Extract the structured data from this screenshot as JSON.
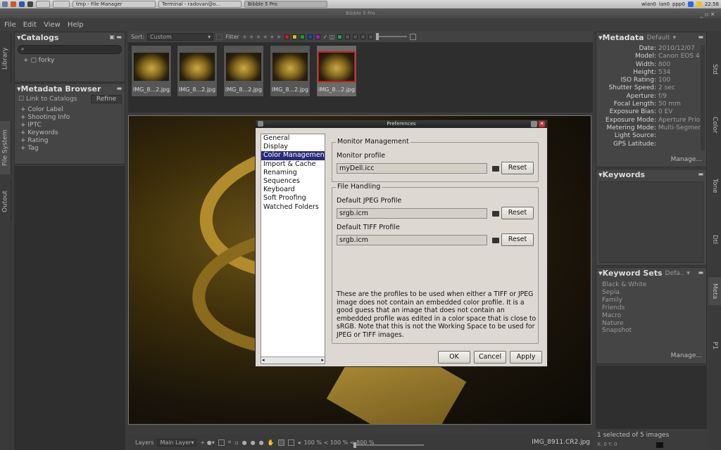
{
  "taskbar": {
    "tasks": [
      "tmp - File Manager",
      "Terminal - radovan@o...",
      "Bibble 5 Pro"
    ],
    "tray": [
      "wlan0",
      "lan0",
      "ppp0"
    ],
    "clock": "22:58"
  },
  "window": {
    "title": "Bibble 5 Pro"
  },
  "menu": [
    "File",
    "Edit",
    "View",
    "Help"
  ],
  "left_tabs": [
    "Library",
    "File System",
    "Outout"
  ],
  "right_tabs": [
    "Std",
    "Color",
    "Tone",
    "Dtl",
    "Meta",
    "P1"
  ],
  "catalogs": {
    "title": "Catalogs",
    "search_placeholder": "",
    "items": [
      "forky"
    ]
  },
  "metadata_browser": {
    "title": "Metadata Browser",
    "link_label": "Link to Catalogs",
    "refine_label": "Refine",
    "items": [
      "Color Label",
      "Shooting Info",
      "IPTC",
      "Keywords",
      "Rating",
      "Tag"
    ]
  },
  "toolbar": {
    "sort_label": "Sort:",
    "sort_value": "Custom",
    "filter_label": "Filter"
  },
  "filmstrip": {
    "thumbs": [
      "IMG_8...2.jpg",
      "IMG_8...2.jpg",
      "IMG_8...2.jpg",
      "IMG_8...2.jpg",
      "IMG_8...2.jpg"
    ],
    "selected_index": 4
  },
  "metadata": {
    "title": "Metadata",
    "preset": "Default",
    "rows": [
      {
        "k": "Date:",
        "v": "2010/12/07"
      },
      {
        "k": "Model:",
        "v": "Canon EOS 4"
      },
      {
        "k": "Width:",
        "v": "800"
      },
      {
        "k": "Height:",
        "v": "534"
      },
      {
        "k": "ISO Rating:",
        "v": "100"
      },
      {
        "k": "Shutter Speed:",
        "v": "2 sec"
      },
      {
        "k": "Aperture:",
        "v": "f/9"
      },
      {
        "k": "Focal Length:",
        "v": "50 mm"
      },
      {
        "k": "Exposure Bias:",
        "v": "0 EV"
      },
      {
        "k": "Exposure Mode:",
        "v": "Aperture Prio"
      },
      {
        "k": "Metering Mode:",
        "v": "Multi-Segmen"
      },
      {
        "k": "Light Source:",
        "v": ""
      },
      {
        "k": "GPS Latitude:",
        "v": ""
      }
    ],
    "manage_label": "Manage..."
  },
  "keywords": {
    "title": "Keywords"
  },
  "keyword_sets": {
    "title": "Keyword Sets",
    "preset": "Defa..",
    "items": [
      "Black & White",
      "Sepia",
      "Family",
      "Friends",
      "Macro",
      "Nature",
      "Snapshot"
    ],
    "manage_label": "Manage..."
  },
  "dialog": {
    "title": "Preferences",
    "categories": [
      "General",
      "Display",
      "Color Management",
      "Import & Cache",
      "Renaming",
      "Sequences",
      "Keyboard",
      "Soft Proofing",
      "Watched Folders"
    ],
    "selected_category": 2,
    "monitor_group": "Monitor Management",
    "monitor_profile_label": "Monitor profile",
    "monitor_profile_value": "myDell.icc",
    "file_group": "File Handling",
    "jpeg_label": "Default JPEG Profile",
    "jpeg_value": "srgb.icm",
    "tiff_label": "Default TIFF Profile",
    "tiff_value": "srgb.icm",
    "reset_label": "Reset",
    "description": "These are the profiles to be used when either a TIFF or JPEG image does not contain an embedded color profile. It is a good guess that an image that does not contain an embedded profile was edited in a color space that is close to sRGB. Note that this is not the Working Space to be used for JPEG or TIFF images.",
    "ok_label": "OK",
    "cancel_label": "Cancel",
    "apply_label": "Apply"
  },
  "bottombar": {
    "layers_label": "Layers",
    "layer_value": "Main Layer",
    "zoom_text": "100 % < 100 % < 800 %",
    "filename": "IMG_8911.CR2.jpg"
  },
  "status": {
    "selection": "1 selected of 5 images",
    "coords": "X: 0 Y: 0"
  }
}
